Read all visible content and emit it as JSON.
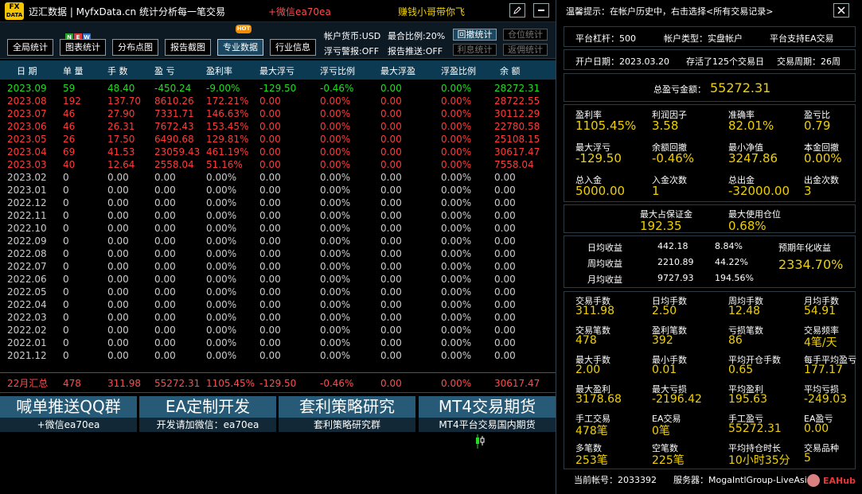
{
  "header": {
    "logo_top": "FX",
    "logo_bottom": "DATA",
    "title": "迈汇数据 | MyfxData.cn  统计分析每一笔交易",
    "wechat": "+微信ea70ea",
    "slogan": "赚钱小哥带你飞"
  },
  "toolbar": {
    "buttons": [
      "全局统计",
      "图表统计",
      "分布点图",
      "报告截图",
      "专业数据",
      "行业信息"
    ],
    "new_badge": [
      "N",
      "E",
      "W"
    ],
    "hot_badge": "HOT",
    "info": {
      "currency": "帐户货币:USD",
      "max_ratio": "最合比例:20%",
      "float_warn": "浮亏警报:OFF",
      "report_push": "报告推送:OFF"
    },
    "small_buttons": [
      "回撤统计",
      "仓位统计",
      "利息统计",
      "返佣统计"
    ]
  },
  "table": {
    "columns": [
      "日 期",
      "单 量",
      "手 数",
      "盈 亏",
      "盈利率",
      "最大浮亏",
      "浮亏比例",
      "最大浮盈",
      "浮盈比例",
      "余 额"
    ],
    "rows": [
      [
        "2023.09",
        "59",
        "48.40",
        "-450.24",
        "-9.00%",
        "-129.50",
        "-0.46%",
        "0.00",
        "0.00%",
        "28272.31"
      ],
      [
        "2023.08",
        "192",
        "137.70",
        "8610.26",
        "172.21%",
        "0.00",
        "0.00%",
        "0.00",
        "0.00%",
        "28722.55"
      ],
      [
        "2023.07",
        "46",
        "27.90",
        "7331.71",
        "146.63%",
        "0.00",
        "0.00%",
        "0.00",
        "0.00%",
        "30112.29"
      ],
      [
        "2023.06",
        "46",
        "26.31",
        "7672.43",
        "153.45%",
        "0.00",
        "0.00%",
        "0.00",
        "0.00%",
        "22780.58"
      ],
      [
        "2023.05",
        "26",
        "17.50",
        "6490.68",
        "129.81%",
        "0.00",
        "0.00%",
        "0.00",
        "0.00%",
        "25108.15"
      ],
      [
        "2023.04",
        "69",
        "41.53",
        "23059.43",
        "461.19%",
        "0.00",
        "0.00%",
        "0.00",
        "0.00%",
        "30617.47"
      ],
      [
        "2023.03",
        "40",
        "12.64",
        "2558.04",
        "51.16%",
        "0.00",
        "0.00%",
        "0.00",
        "0.00%",
        "7558.04"
      ],
      [
        "2023.02",
        "0",
        "0.00",
        "0.00",
        "0.00%",
        "0.00",
        "0.00%",
        "0.00",
        "0.00%",
        "0.00"
      ],
      [
        "2023.01",
        "0",
        "0.00",
        "0.00",
        "0.00%",
        "0.00",
        "0.00%",
        "0.00",
        "0.00%",
        "0.00"
      ],
      [
        "2022.12",
        "0",
        "0.00",
        "0.00",
        "0.00%",
        "0.00",
        "0.00%",
        "0.00",
        "0.00%",
        "0.00"
      ],
      [
        "2022.11",
        "0",
        "0.00",
        "0.00",
        "0.00%",
        "0.00",
        "0.00%",
        "0.00",
        "0.00%",
        "0.00"
      ],
      [
        "2022.10",
        "0",
        "0.00",
        "0.00",
        "0.00%",
        "0.00",
        "0.00%",
        "0.00",
        "0.00%",
        "0.00"
      ],
      [
        "2022.09",
        "0",
        "0.00",
        "0.00",
        "0.00%",
        "0.00",
        "0.00%",
        "0.00",
        "0.00%",
        "0.00"
      ],
      [
        "2022.08",
        "0",
        "0.00",
        "0.00",
        "0.00%",
        "0.00",
        "0.00%",
        "0.00",
        "0.00%",
        "0.00"
      ],
      [
        "2022.07",
        "0",
        "0.00",
        "0.00",
        "0.00%",
        "0.00",
        "0.00%",
        "0.00",
        "0.00%",
        "0.00"
      ],
      [
        "2022.06",
        "0",
        "0.00",
        "0.00",
        "0.00%",
        "0.00",
        "0.00%",
        "0.00",
        "0.00%",
        "0.00"
      ],
      [
        "2022.05",
        "0",
        "0.00",
        "0.00",
        "0.00%",
        "0.00",
        "0.00%",
        "0.00",
        "0.00%",
        "0.00"
      ],
      [
        "2022.04",
        "0",
        "0.00",
        "0.00",
        "0.00%",
        "0.00",
        "0.00%",
        "0.00",
        "0.00%",
        "0.00"
      ],
      [
        "2022.03",
        "0",
        "0.00",
        "0.00",
        "0.00%",
        "0.00",
        "0.00%",
        "0.00",
        "0.00%",
        "0.00"
      ],
      [
        "2022.02",
        "0",
        "0.00",
        "0.00",
        "0.00%",
        "0.00",
        "0.00%",
        "0.00",
        "0.00%",
        "0.00"
      ],
      [
        "2022.01",
        "0",
        "0.00",
        "0.00",
        "0.00%",
        "0.00",
        "0.00%",
        "0.00",
        "0.00%",
        "0.00"
      ],
      [
        "2021.12",
        "0",
        "0.00",
        "0.00",
        "0.00%",
        "0.00",
        "0.00%",
        "0.00",
        "0.00%",
        "0.00"
      ]
    ],
    "row_colors": [
      "#22dd22",
      "#ff3b3b",
      "#ff3b3b",
      "#ff3b3b",
      "#ff3b3b",
      "#ff3b3b",
      "#ff3b3b",
      "#cccccc"
    ],
    "summary": [
      "22月汇总",
      "478",
      "311.98",
      "55272.31",
      "1105.45%",
      "-129.50",
      "-0.46%",
      "0.00",
      "0.00%",
      "30617.47"
    ]
  },
  "promo": [
    {
      "title": "喊单推送QQ群",
      "sub": "+微信ea70ea"
    },
    {
      "title": "EA定制开发",
      "sub": "开发请加微信：ea70ea"
    },
    {
      "title": "套利策略研究",
      "sub": "套利策略研究群"
    },
    {
      "title": "MT4交易期货",
      "sub": "MT4平台交易国内期货"
    }
  ],
  "right": {
    "tip": "温馨提示：在帐户历史中，右击选择<所有交易记录>",
    "leverage": "平台杠杆：500",
    "account_type": "帐户类型：实盘帐户",
    "ea_support": "平台支持EA交易",
    "open_date": "开户日期：2023.03.20",
    "survived": "存活了125个交易日",
    "cycle": "交易周期：26周",
    "total_pnl_label": "总盈亏金额：",
    "total_pnl": "55272.31",
    "grid1": [
      {
        "label": "盈利率",
        "value": "1105.45%"
      },
      {
        "label": "利润因子",
        "value": "3.58"
      },
      {
        "label": "准确率",
        "value": "82.01%"
      },
      {
        "label": "盈亏比",
        "value": "0.79"
      },
      {
        "label": "最大浮亏",
        "value": "-129.50"
      },
      {
        "label": "余额回撤",
        "value": "-0.46%"
      },
      {
        "label": "最小净值",
        "value": "3247.86"
      },
      {
        "label": "本金回撤",
        "value": "0.00%"
      },
      {
        "label": "总入金",
        "value": "5000.00"
      },
      {
        "label": "入金次数",
        "value": "1"
      },
      {
        "label": "总出金",
        "value": "-32000.00"
      },
      {
        "label": "出金次数",
        "value": "3"
      }
    ],
    "margin": [
      {
        "label": "最大占保证金",
        "value": "192.35"
      },
      {
        "label": "最大使用仓位",
        "value": "0.68%"
      }
    ],
    "returns": [
      {
        "label": "日均收益",
        "value": "442.18",
        "pct": "8.84%"
      },
      {
        "label": "周均收益",
        "value": "2210.89",
        "pct": "44.22%"
      },
      {
        "label": "月均收益",
        "value": "9727.93",
        "pct": "194.56%"
      }
    ],
    "annual_label": "预期年化收益",
    "annual_value": "2334.70%",
    "grid2": [
      {
        "label": "交易手数",
        "value": "311.98"
      },
      {
        "label": "日均手数",
        "value": "2.50"
      },
      {
        "label": "周均手数",
        "value": "12.48"
      },
      {
        "label": "月均手数",
        "value": "54.91"
      },
      {
        "label": "交易笔数",
        "value": "478"
      },
      {
        "label": "盈利笔数",
        "value": "392"
      },
      {
        "label": "亏损笔数",
        "value": "86"
      },
      {
        "label": "交易频率",
        "value": "4笔/天"
      },
      {
        "label": "最大手数",
        "value": "2.00"
      },
      {
        "label": "最小手数",
        "value": "0.01"
      },
      {
        "label": "平均开仓手数",
        "value": "0.65"
      },
      {
        "label": "每手平均盈亏",
        "value": "177.17"
      },
      {
        "label": "最大盈利",
        "value": "3178.68"
      },
      {
        "label": "最大亏损",
        "value": "-2196.42"
      },
      {
        "label": "平均盈利",
        "value": "195.63"
      },
      {
        "label": "平均亏损",
        "value": "-249.03"
      },
      {
        "label": "手工交易",
        "value": "478笔"
      },
      {
        "label": "EA交易",
        "value": "0笔"
      },
      {
        "label": "手工盈亏",
        "value": "55272.31"
      },
      {
        "label": "EA盈亏",
        "value": "0.00"
      },
      {
        "label": "多笔数",
        "value": "253笔"
      },
      {
        "label": "空笔数",
        "value": "225笔"
      },
      {
        "label": "平均持仓时长",
        "value": "10小时35分"
      },
      {
        "label": "交易品种",
        "value": "5"
      }
    ],
    "account_no": "当前帐号：2033392",
    "server": "服务器：MogaIntlGroup-LiveAsia",
    "brand": "EAHub"
  },
  "colors": {
    "accent_yellow": "#f0d000",
    "profit_red": "#ff3b3b",
    "loss_green": "#22dd22",
    "header_blue": "#0c3a52"
  },
  "icons": {
    "edit": "pencil-icon",
    "minimize": "minimize-icon",
    "close": "close-icon"
  }
}
